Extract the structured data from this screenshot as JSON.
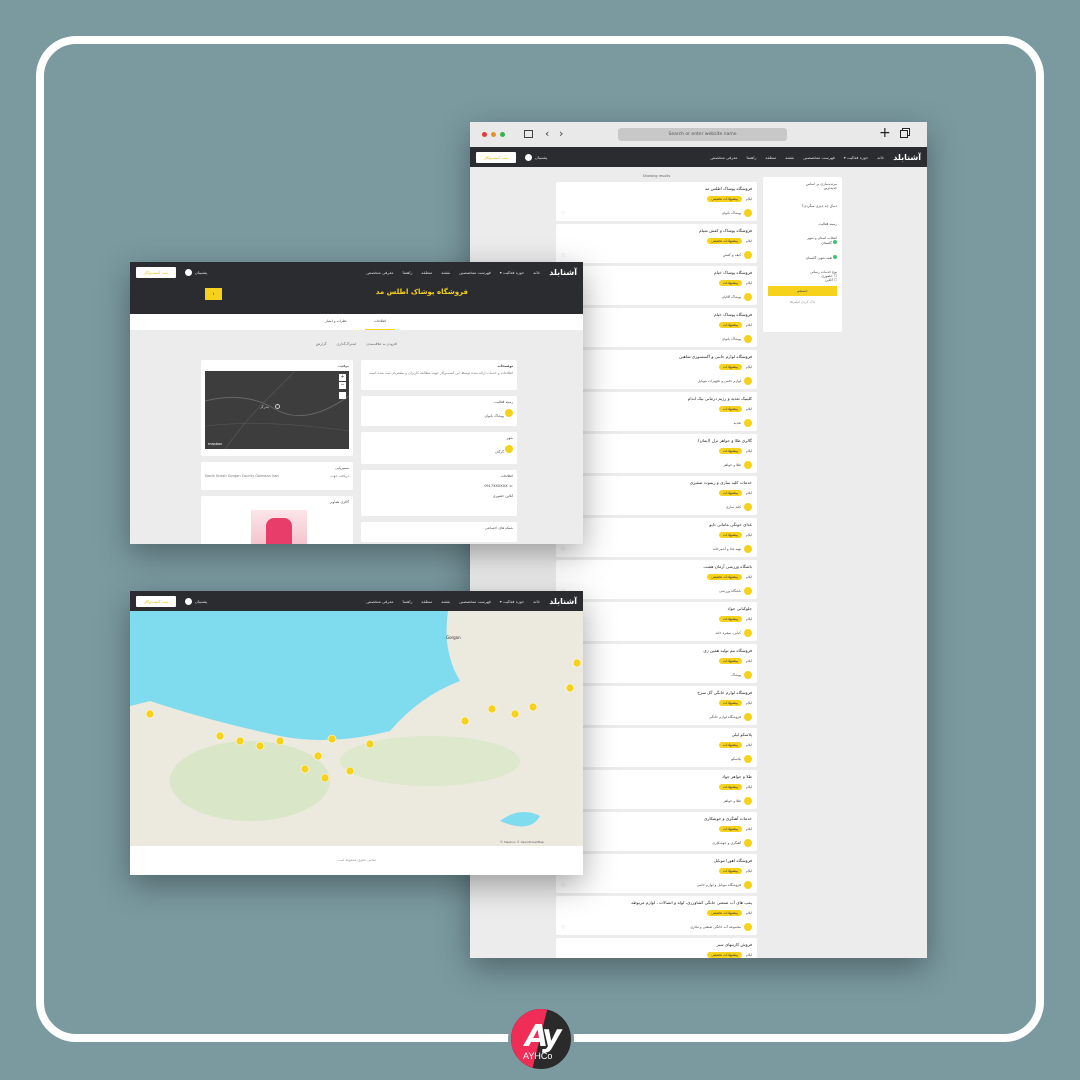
{
  "nav": {
    "brand": "آشنابلد",
    "items": [
      "خانه",
      "حوزه فعالیت ▾",
      "فهرست متخصصین",
      "نقشه",
      "منطقه",
      "راهنما",
      "معرفی متخصص"
    ],
    "support": "پشتیبان",
    "register": "ثبت کسب‌وکار"
  },
  "browser": {
    "search_placeholder": "Search or enter website name"
  },
  "listing": {
    "header": "Showing results",
    "cards": [
      {
        "title": "فروشگاه پوشاک اطلس مد",
        "city": "ایلام",
        "badge": "پیشنهادات تخفیفی",
        "cat": "پوشاک بانوان"
      },
      {
        "title": "فروشگاه پوشاک و کفش شیام",
        "city": "ایلام",
        "badge": "پیشنهادات تخفیفی",
        "cat": "کیف و کفش"
      },
      {
        "title": "فروشگاه پوشاک خیام",
        "city": "ایلام",
        "badge": "پیشنهادات",
        "cat": "پوشاک آقایان"
      },
      {
        "title": "فروشگاه پوشاک خیام",
        "city": "ایلام",
        "badge": "پیشنهادات",
        "cat": "پوشاک بانوان"
      },
      {
        "title": "فروشگاه لوازم جانبی و آکسسوری شاهین",
        "city": "ایلام",
        "badge": "پیشنهادات",
        "cat": "لوازم جانبی و تجهیزات موبایل"
      },
      {
        "title": "کلینیک تغذیه و رژیم درمانی نیک اندام",
        "city": "ایلام",
        "badge": "پیشنهادات",
        "cat": "تغذیه"
      },
      {
        "title": "گالری طلا و جواهر تزل (ایمان)",
        "city": "ایلام",
        "badge": "پیشنهادات",
        "cat": "طلا و جواهر"
      },
      {
        "title": "خدمات کلید سازی و ریموت صفیری",
        "city": "ایلام",
        "badge": "پیشنهادات",
        "cat": "کلید سازی"
      },
      {
        "title": "غذای خونگی مامانی دایو",
        "city": "ایلام",
        "badge": "پیشنهادات",
        "cat": "تهیه غذا و آشپزخانه"
      },
      {
        "title": "باشگاه ورزشی آرمان هشت",
        "city": "ایلام",
        "badge": "پیشنهادات تخفیفی",
        "cat": "باشگاه ورزشی"
      },
      {
        "title": "جلوکبابی جواد",
        "city": "ایلام",
        "badge": "پیشنهادات",
        "cat": "کبابی، سفره خانه"
      },
      {
        "title": "فروشگاه تیم تولید همین زی",
        "city": "ایلام",
        "badge": "پیشنهادات",
        "cat": "پوشاک"
      },
      {
        "title": "فروشگاه لوازم خانگی گل سرخ",
        "city": "ایلام",
        "badge": "پیشنهادات",
        "cat": "فروشگاه لوازم خانگی"
      },
      {
        "title": "پلاسکو لیلی",
        "city": "ایلام",
        "badge": "پیشنهادات",
        "cat": "پلاسکو"
      },
      {
        "title": "طلا و جواهر جواد",
        "city": "ایلام",
        "badge": "پیشنهادات",
        "cat": "طلا و جواهر"
      },
      {
        "title": "خدمات آهنگری و جوشکاری",
        "city": "ایلام",
        "badge": "پیشنهادات",
        "cat": "آهنگری و جوشکاری"
      },
      {
        "title": "فروشگاه اهورا موبایل",
        "city": "ایلام",
        "badge": "پیشنهادات",
        "cat": "فروشگاه موبایل و لوازم جانبی"
      },
      {
        "title": "پمپ های آب صنعتی خانگی کشاورزی، لوله و اتصالات ، لوازم مربوطه",
        "city": "ایلام",
        "badge": "پیشنهادات تخفیفی",
        "cat": "مجموعه آب خانگی صنعتی و تجاری"
      },
      {
        "title": "فروش کارتنهای سبز",
        "city": "ایلام",
        "badge": "پیشنهادات تخفیفی",
        "cat": ""
      }
    ]
  },
  "filter": {
    "sort_label": "مرتب‌سازی بر اساس",
    "sort_value": "جدیدترین",
    "search_label": "دنبال چه چیزی میگردی؟",
    "activity": "زمینه فعالیت",
    "province_label": "انتخاب استان و شهر",
    "province": "گلستان",
    "city": "همه شهر: گلستان",
    "service_label": "نوع خدمات رسانی",
    "opt1": "حضوری",
    "opt2": "آنلاین",
    "search_btn": "جستجو",
    "clear": "پاک کردن فیلترها"
  },
  "detail": {
    "title": "فروشگاه پوشاک اطلس مد",
    "hero_btn": "۱",
    "tabs": [
      "اطلاعات",
      "نظرات و امتیاز"
    ],
    "actions": [
      "افزودن به علاقه‌مندی",
      "اشتراک‌گذاری",
      "گزارش"
    ],
    "location": "موقعیت",
    "map_city": "بندرگز",
    "map_brand": "mapbox",
    "about_title": "توضیحات",
    "about": "اطلاعات و خدمات ارائه شده توسط این کسب‌وکار جهت مطالعه کاربران و مشتریان ثبت شده است",
    "activity_title": "زمینه فعالیت",
    "activity": "پوشاک بانوان",
    "city_title": "شهر",
    "city": "گرگان",
    "contact_title": "اطلاعات",
    "phone": "0917XXXXXX",
    "mode": "آنلاین حضوری",
    "address_title": "مسیریابی",
    "address": "Navin Kuesh Gorgan County Golestan Iran",
    "address_link": "دریافت جهت",
    "gallery_title": "گالری تصاویر",
    "social_title": "شبکه های اجتماعی"
  },
  "map": {
    "city_label": "Gorgan",
    "attribution": "© Mapbox © OpenStreetMap",
    "footer": "تمامی حقوق محفوظ است"
  },
  "brand_logo": "AYHCo",
  "colors": {
    "accent": "#f6d21c",
    "dark": "#2b2c30",
    "sea": "#7fdcef"
  }
}
